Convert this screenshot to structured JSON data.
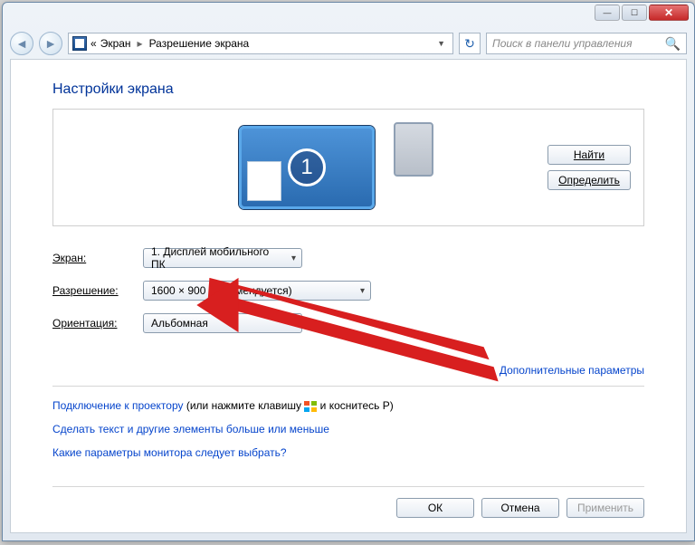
{
  "window": {
    "minimize_icon": "—",
    "maximize_icon": "☐",
    "close_icon": "✕"
  },
  "breadcrumb": {
    "prefix": "«",
    "item1": "Экран",
    "item2": "Разрешение экрана"
  },
  "search": {
    "placeholder": "Поиск в панели управления"
  },
  "page_title": "Настройки экрана",
  "preview": {
    "monitor_number": "1",
    "find_label": "Найти",
    "detect_label": "Определить"
  },
  "form": {
    "display_label": "Экран:",
    "display_value": "1. Дисплей мобильного ПК",
    "resolution_label": "Разрешение:",
    "resolution_value": "1600 × 900 (рекомендуется)",
    "orientation_label": "Ориентация:",
    "orientation_value": "Альбомная"
  },
  "advanced_link": "Дополнительные параметры",
  "links": {
    "projector_link": "Подключение к проектору",
    "projector_suffix_1": " (или нажмите клавишу ",
    "projector_suffix_2": " и коснитесь P)",
    "text_size_link": "Сделать текст и другие элементы больше или меньше",
    "which_params_link": "Какие параметры монитора следует выбрать?"
  },
  "footer": {
    "ok": "ОК",
    "cancel": "Отмена",
    "apply": "Применить"
  }
}
